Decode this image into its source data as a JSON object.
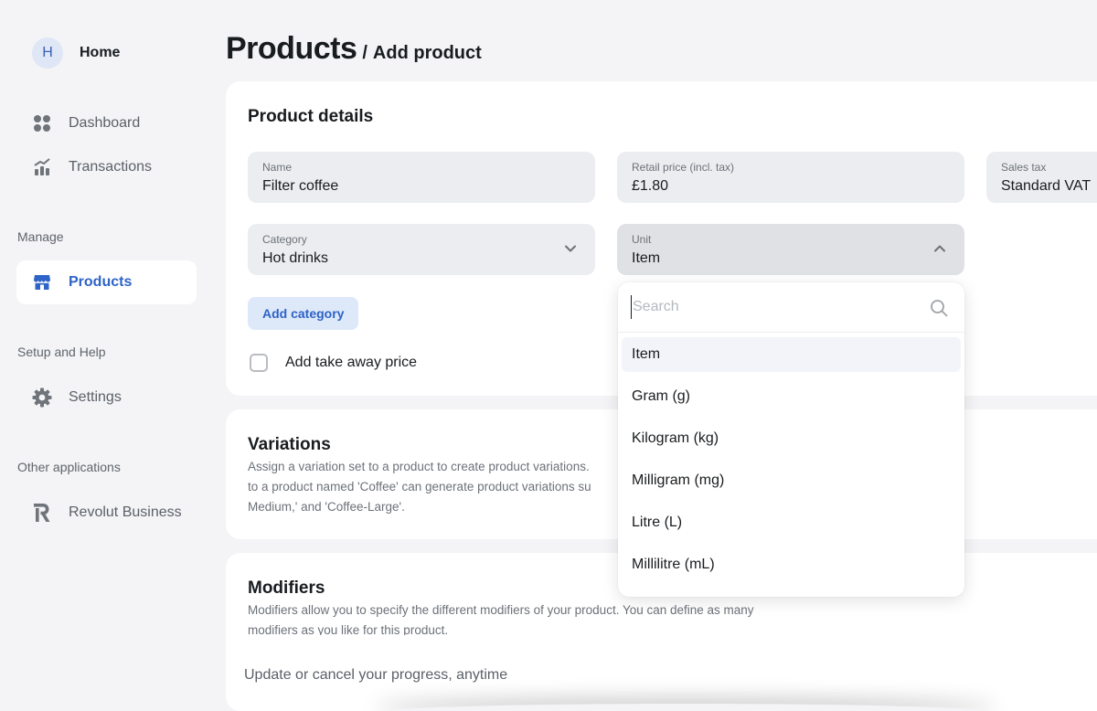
{
  "sidebar": {
    "avatar_initial": "H",
    "home_label": "Home",
    "items": [
      {
        "label": "Dashboard"
      },
      {
        "label": "Transactions"
      },
      {
        "label": "Products"
      },
      {
        "label": "Settings"
      },
      {
        "label": "Revolut Business"
      }
    ],
    "sections": {
      "manage": "Manage",
      "setup": "Setup and Help",
      "other": "Other applications"
    }
  },
  "header": {
    "title": "Products",
    "separator": "/",
    "subtitle": "Add product"
  },
  "details": {
    "title": "Product details",
    "name": {
      "label": "Name",
      "value": "Filter coffee"
    },
    "price": {
      "label": "Retail price (incl. tax)",
      "value": "£1.80"
    },
    "tax": {
      "label": "Sales tax",
      "value": "Standard VAT"
    },
    "category": {
      "label": "Category",
      "value": "Hot drinks"
    },
    "unit": {
      "label": "Unit",
      "value": "Item"
    },
    "add_category": "Add category",
    "takeaway_label": "Add take away price"
  },
  "unit_dropdown": {
    "search_placeholder": "Search",
    "options": [
      "Item",
      "Gram (g)",
      "Kilogram (kg)",
      "Milligram (mg)",
      "Litre (L)",
      "Millilitre (mL)"
    ],
    "selected": "Item"
  },
  "variations": {
    "title": "Variations",
    "desc_1": "Assign a variation set to a product to create product variations.",
    "desc_2": "to a product named 'Coffee' can generate product variations su",
    "desc_3": "Medium,' and 'Coffee-Large'."
  },
  "modifiers": {
    "title": "Modifiers",
    "desc_1": "Modifiers allow you to specify the different modifiers of your product. You can define as many",
    "desc_2": "modifiers as you like for this product."
  },
  "footer": {
    "progress_text": "Update or cancel your progress, anytime"
  },
  "colors": {
    "accent": "#2e63c7",
    "background": "#f4f4f6",
    "field": "#ebedf0"
  }
}
